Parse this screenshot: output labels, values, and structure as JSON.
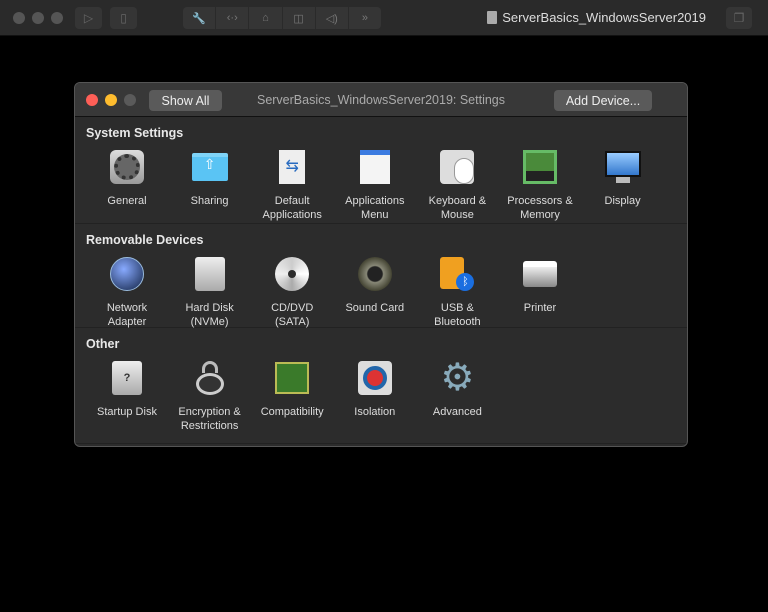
{
  "toolbar": {
    "vm_title": "ServerBasics_WindowsServer2019"
  },
  "window": {
    "title": "ServerBasics_WindowsServer2019: Settings",
    "show_all": "Show All",
    "add_device": "Add Device..."
  },
  "sections": [
    {
      "title": "System Settings",
      "items": [
        {
          "l1": "General",
          "l2": ""
        },
        {
          "l1": "Sharing",
          "l2": ""
        },
        {
          "l1": "Default",
          "l2": "Applications"
        },
        {
          "l1": "Applications",
          "l2": "Menu"
        },
        {
          "l1": "Keyboard &",
          "l2": "Mouse"
        },
        {
          "l1": "Processors &",
          "l2": "Memory"
        },
        {
          "l1": "Display",
          "l2": ""
        }
      ]
    },
    {
      "title": "Removable Devices",
      "items": [
        {
          "l1": "Network",
          "l2": "Adapter"
        },
        {
          "l1": "Hard Disk",
          "l2": "(NVMe)"
        },
        {
          "l1": "CD/DVD",
          "l2": "(SATA)"
        },
        {
          "l1": "Sound Card",
          "l2": ""
        },
        {
          "l1": "USB &",
          "l2": "Bluetooth"
        },
        {
          "l1": "Printer",
          "l2": ""
        }
      ]
    },
    {
      "title": "Other",
      "items": [
        {
          "l1": "Startup Disk",
          "l2": ""
        },
        {
          "l1": "Encryption &",
          "l2": "Restrictions"
        },
        {
          "l1": "Compatibility",
          "l2": ""
        },
        {
          "l1": "Isolation",
          "l2": ""
        },
        {
          "l1": "Advanced",
          "l2": ""
        }
      ]
    }
  ]
}
